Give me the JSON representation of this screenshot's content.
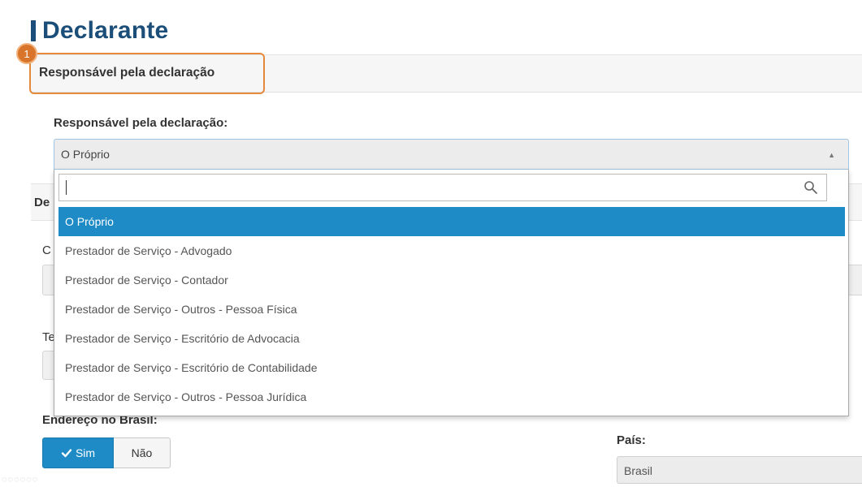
{
  "page": {
    "title": "Declarante"
  },
  "section": {
    "title": "Responsável pela declaração",
    "step_badge": "1"
  },
  "field": {
    "label": "Responsável pela declaração:",
    "selected_value": "O Próprio"
  },
  "dropdown": {
    "search_value": "",
    "options": [
      {
        "label": "O Próprio",
        "selected": true
      },
      {
        "label": "Prestador de Serviço - Advogado",
        "selected": false
      },
      {
        "label": "Prestador de Serviço - Contador",
        "selected": false
      },
      {
        "label": "Prestador de Serviço - Outros - Pessoa Física",
        "selected": false
      },
      {
        "label": "Prestador de Serviço - Escritório de Advocacia",
        "selected": false
      },
      {
        "label": "Prestador de Serviço - Escritório de Contabilidade",
        "selected": false
      },
      {
        "label": "Prestador de Serviço - Outros - Pessoa Jurídica",
        "selected": false
      }
    ]
  },
  "background": {
    "section2_fragment": "De",
    "field_fragment_c": "C",
    "field_fragment_te": "Te"
  },
  "endereco": {
    "label": "Endereço no Brasil:",
    "yes_label": "Sim",
    "no_label": "Não"
  },
  "pais": {
    "label": "País:",
    "value": "Brasil"
  },
  "colors": {
    "accent": "#1e8bc7",
    "title": "#1b4f7a",
    "highlight": "#e58a3c"
  }
}
